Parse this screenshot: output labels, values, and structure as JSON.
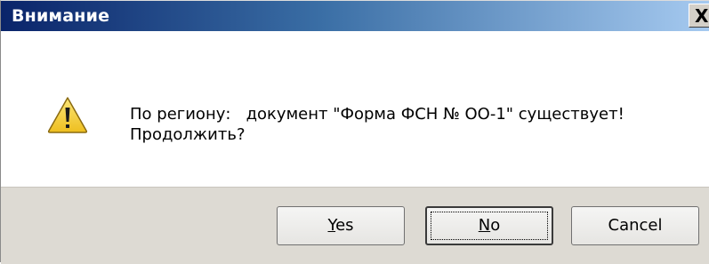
{
  "dialog": {
    "title": "Внимание",
    "close_glyph": "X",
    "icon": "warning-icon",
    "message_line1": "По региону:   документ \"Форма ФСН № ОО-1\" существует!",
    "message_line2": "Продолжить?"
  },
  "buttons": {
    "yes": {
      "mnemonic": "Y",
      "rest": "es"
    },
    "no": {
      "mnemonic": "N",
      "rest": "o"
    },
    "cancel": "Cancel"
  },
  "colors": {
    "title_start": "#0a246a",
    "title_end": "#a6caf0",
    "button_area": "#dddad3",
    "warning_fill": "#f5d33a"
  }
}
